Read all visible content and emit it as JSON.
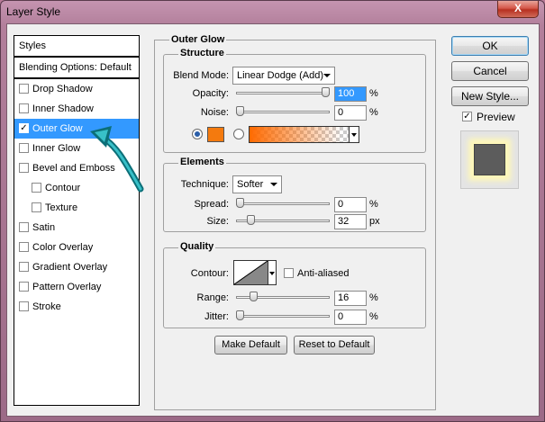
{
  "window": {
    "title": "Layer Style",
    "close_glyph": "X"
  },
  "styles_panel": {
    "header": "Styles",
    "blending": "Blending Options: Default",
    "items": [
      {
        "label": "Drop Shadow",
        "checked": false,
        "sub": false
      },
      {
        "label": "Inner Shadow",
        "checked": false,
        "sub": false
      },
      {
        "label": "Outer Glow",
        "checked": true,
        "sub": false,
        "selected": true
      },
      {
        "label": "Inner Glow",
        "checked": false,
        "sub": false
      },
      {
        "label": "Bevel and Emboss",
        "checked": false,
        "sub": false
      },
      {
        "label": "Contour",
        "checked": false,
        "sub": true
      },
      {
        "label": "Texture",
        "checked": false,
        "sub": true
      },
      {
        "label": "Satin",
        "checked": false,
        "sub": false
      },
      {
        "label": "Color Overlay",
        "checked": false,
        "sub": false
      },
      {
        "label": "Gradient Overlay",
        "checked": false,
        "sub": false
      },
      {
        "label": "Pattern Overlay",
        "checked": false,
        "sub": false
      },
      {
        "label": "Stroke",
        "checked": false,
        "sub": false
      }
    ],
    "check_glyph": "✓"
  },
  "panel": {
    "title": "Outer Glow",
    "structure": {
      "title": "Structure",
      "blend_mode_label": "Blend Mode:",
      "blend_mode_value": "Linear Dodge (Add)",
      "opacity_label": "Opacity:",
      "opacity_value": "100",
      "opacity_level": 1.0,
      "noise_label": "Noise:",
      "noise_value": "0",
      "noise_level": 0,
      "percent": "%",
      "glow_color": "#f47a0e"
    },
    "elements": {
      "title": "Elements",
      "technique_label": "Technique:",
      "technique_value": "Softer",
      "spread_label": "Spread:",
      "spread_value": "0",
      "spread_level": 0,
      "size_label": "Size:",
      "size_value": "32",
      "size_level": 0.13,
      "percent": "%",
      "px": "px"
    },
    "quality": {
      "title": "Quality",
      "contour_label": "Contour:",
      "anti_aliased_label": "Anti-aliased",
      "range_label": "Range:",
      "range_value": "16",
      "range_level": 0.16,
      "jitter_label": "Jitter:",
      "jitter_value": "0",
      "jitter_level": 0,
      "percent": "%"
    },
    "make_default": "Make Default",
    "reset_default": "Reset to Default"
  },
  "side": {
    "ok": "OK",
    "cancel": "Cancel",
    "new_style": "New Style...",
    "preview_label": "Preview",
    "preview_checked": true
  }
}
